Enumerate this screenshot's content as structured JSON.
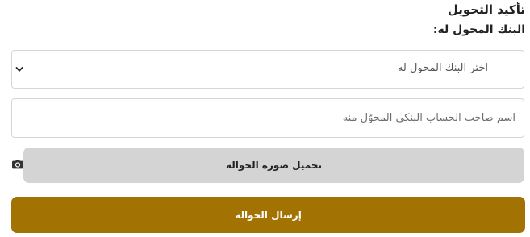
{
  "form": {
    "title": "تأكيد التحويل",
    "bank_label": "البنك المحول له:",
    "bank_select": {
      "selected": "اختر البنك المحول له",
      "icon": "chevron-down-icon"
    },
    "account_holder": {
      "placeholder": "اسم صاحب الحساب البنكي المحوّل منه",
      "value": ""
    },
    "upload": {
      "label": "تحميل صورة الحوالة",
      "icon": "camera-icon"
    },
    "submit": {
      "label": "إرسال الحوالة"
    }
  },
  "colors": {
    "submit_background": "#a27302",
    "upload_background": "#d4d4d4",
    "border": "#d6d6d6"
  }
}
